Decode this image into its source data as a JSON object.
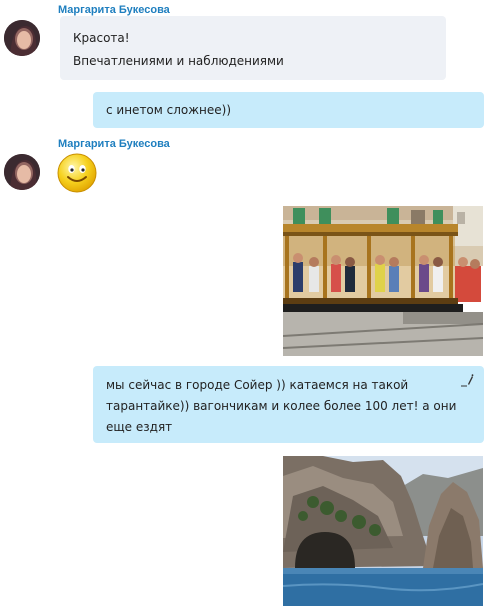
{
  "messages": [
    {
      "type": "incoming",
      "sender": "Маргарита Букесова",
      "lines": [
        "Красота!",
        "Впечатлениями и наблюдениями"
      ]
    },
    {
      "type": "outgoing",
      "text": "с инетом сложнее))"
    },
    {
      "type": "incoming",
      "sender": "Маргарита Букесова",
      "emoticon": "smile-emoticon"
    },
    {
      "type": "outgoing",
      "photo": "tram-photo"
    },
    {
      "type": "outgoing",
      "lines": [
        "мы сейчас в городе Сойер )) катаемся на такой",
        "тарантайке)) вагончикам и колее более 100 лет! а они",
        "еще ездят"
      ],
      "edit_icon": "pencil-edit-icon"
    },
    {
      "type": "outgoing",
      "photo": "sea-cliff-photo"
    }
  ],
  "colors": {
    "sender_name": "#1f7fbf",
    "incoming_bubble": "#eef1f6",
    "outgoing_bubble": "#c7ebfb"
  }
}
